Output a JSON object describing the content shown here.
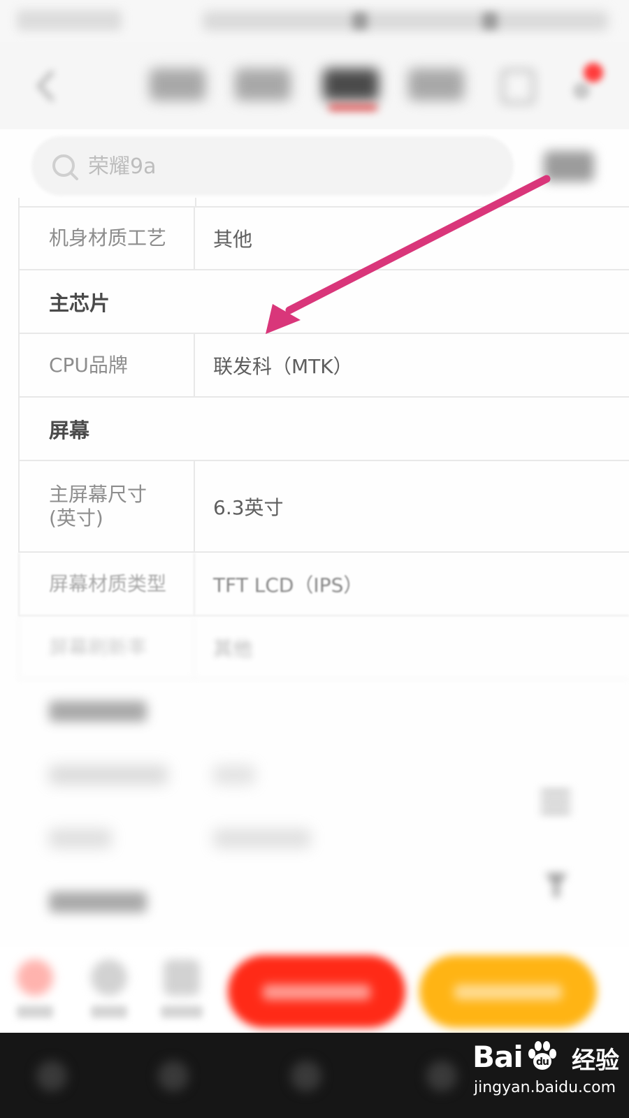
{
  "search": {
    "placeholder": "荣耀9a"
  },
  "spec_table": {
    "rows": [
      {
        "type": "spec",
        "label": "机身材质工艺",
        "value": "其他"
      },
      {
        "type": "section",
        "title": "主芯片"
      },
      {
        "type": "spec",
        "label": "CPU品牌",
        "value": "联发科（MTK）"
      },
      {
        "type": "section",
        "title": "屏幕"
      },
      {
        "type": "spec",
        "label": "主屏幕尺寸(英寸)",
        "value": "6.3英寸"
      },
      {
        "type": "spec",
        "label": "屏幕材质类型",
        "value": "TFT LCD（IPS）"
      },
      {
        "type": "spec",
        "label": "屏幕刷新率",
        "value": "其他"
      }
    ]
  },
  "annotation": {
    "arrow_color": "#d9367a"
  },
  "bottom_bar": {
    "cart_button_color": "#ff2a17",
    "buy_button_color": "#ffb414"
  },
  "nav": {
    "active_tab_indicator_color": "#e23b3b"
  },
  "watermark": {
    "brand": "Baidu",
    "sub": "经验",
    "url": "jingyan.baidu.com"
  }
}
